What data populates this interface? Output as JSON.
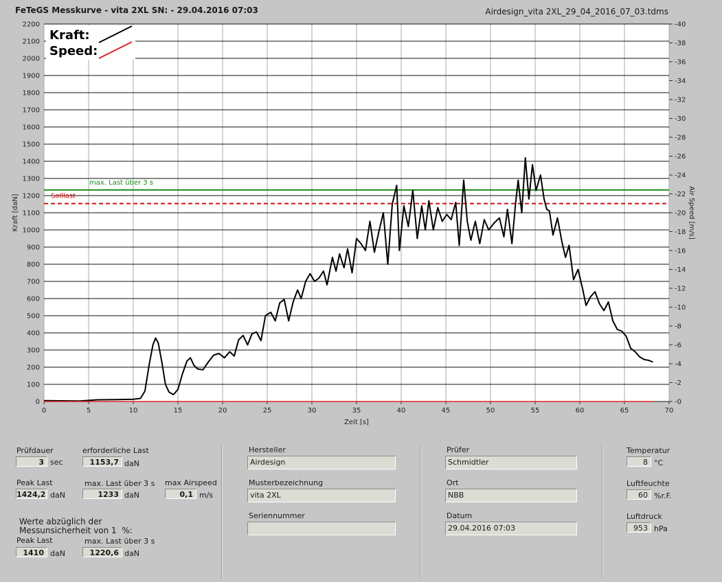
{
  "header": {
    "title": "FeTeGS Messkurve - vita 2XL  SN:  - 29.04.2016 07:03",
    "filename": "Airdesign_vita 2XL_29_04_2016_07_03.tdms"
  },
  "legend": {
    "kraft": "Kraft:",
    "speed": "Speed:"
  },
  "chart_data": {
    "type": "line",
    "xlabel": "Zeit [s]",
    "ylabel": "Kraft [daN]",
    "y2label": "Air Speed [m/s]",
    "xlim": [
      0,
      70
    ],
    "ylim": [
      0,
      2200
    ],
    "y2lim": [
      0,
      40
    ],
    "xticks": [
      0,
      5,
      10,
      15,
      20,
      25,
      30,
      35,
      40,
      45,
      50,
      55,
      60,
      65,
      70
    ],
    "yticks": [
      0,
      100,
      200,
      300,
      400,
      500,
      600,
      700,
      800,
      900,
      1000,
      1100,
      1200,
      1300,
      1400,
      1500,
      1600,
      1700,
      1800,
      1900,
      2000,
      2100,
      2200
    ],
    "y2ticks": [
      0,
      2,
      4,
      6,
      8,
      10,
      12,
      14,
      16,
      18,
      20,
      22,
      24,
      26,
      28,
      30,
      32,
      34,
      36,
      38,
      40
    ],
    "grid": true,
    "reference_lines": [
      {
        "label": "max. Last über  3 s",
        "value": 1233,
        "color": "#1a8a1a",
        "style": "solid"
      },
      {
        "label": "Solllast",
        "value": 1153.7,
        "color": "#cc1111",
        "style": "dashed"
      }
    ],
    "series": [
      {
        "name": "Kraft",
        "color": "#000000",
        "points": [
          [
            0,
            5
          ],
          [
            2,
            4
          ],
          [
            4,
            3
          ],
          [
            6,
            10
          ],
          [
            8,
            11
          ],
          [
            10,
            13
          ],
          [
            10.8,
            18
          ],
          [
            11.3,
            60
          ],
          [
            11.8,
            220
          ],
          [
            12.2,
            330
          ],
          [
            12.5,
            370
          ],
          [
            12.8,
            340
          ],
          [
            13.2,
            230
          ],
          [
            13.6,
            100
          ],
          [
            14,
            55
          ],
          [
            14.5,
            40
          ],
          [
            15,
            70
          ],
          [
            15.5,
            160
          ],
          [
            16,
            235
          ],
          [
            16.4,
            255
          ],
          [
            16.8,
            210
          ],
          [
            17.2,
            190
          ],
          [
            17.8,
            185
          ],
          [
            18.4,
            230
          ],
          [
            19,
            270
          ],
          [
            19.6,
            280
          ],
          [
            20.2,
            255
          ],
          [
            20.8,
            290
          ],
          [
            21.3,
            265
          ],
          [
            21.8,
            360
          ],
          [
            22.3,
            385
          ],
          [
            22.8,
            330
          ],
          [
            23.3,
            395
          ],
          [
            23.8,
            405
          ],
          [
            24.3,
            355
          ],
          [
            24.8,
            500
          ],
          [
            25.4,
            520
          ],
          [
            25.9,
            470
          ],
          [
            26.4,
            575
          ],
          [
            26.9,
            595
          ],
          [
            27.4,
            470
          ],
          [
            27.9,
            580
          ],
          [
            28.4,
            650
          ],
          [
            28.8,
            600
          ],
          [
            29.3,
            700
          ],
          [
            29.8,
            745
          ],
          [
            30.3,
            700
          ],
          [
            30.8,
            720
          ],
          [
            31.3,
            760
          ],
          [
            31.7,
            680
          ],
          [
            32.3,
            840
          ],
          [
            32.7,
            760
          ],
          [
            33.1,
            860
          ],
          [
            33.6,
            780
          ],
          [
            34,
            890
          ],
          [
            34.5,
            750
          ],
          [
            35,
            950
          ],
          [
            35.5,
            920
          ],
          [
            36,
            880
          ],
          [
            36.5,
            1050
          ],
          [
            37,
            870
          ],
          [
            37.5,
            990
          ],
          [
            38,
            1100
          ],
          [
            38.5,
            800
          ],
          [
            39,
            1150
          ],
          [
            39.5,
            1260
          ],
          [
            39.8,
            880
          ],
          [
            40.3,
            1140
          ],
          [
            40.8,
            1020
          ],
          [
            41.3,
            1230
          ],
          [
            41.8,
            950
          ],
          [
            42.3,
            1140
          ],
          [
            42.7,
            1000
          ],
          [
            43.1,
            1170
          ],
          [
            43.6,
            1000
          ],
          [
            44.1,
            1130
          ],
          [
            44.6,
            1050
          ],
          [
            45.1,
            1090
          ],
          [
            45.6,
            1060
          ],
          [
            46.1,
            1160
          ],
          [
            46.5,
            910
          ],
          [
            47,
            1290
          ],
          [
            47.4,
            1050
          ],
          [
            47.8,
            940
          ],
          [
            48.3,
            1050
          ],
          [
            48.8,
            920
          ],
          [
            49.3,
            1060
          ],
          [
            49.8,
            1000
          ],
          [
            50.4,
            1040
          ],
          [
            51,
            1070
          ],
          [
            51.5,
            960
          ],
          [
            51.9,
            1120
          ],
          [
            52.4,
            920
          ],
          [
            52.8,
            1150
          ],
          [
            53.1,
            1290
          ],
          [
            53.5,
            1100
          ],
          [
            53.9,
            1420
          ],
          [
            54.3,
            1180
          ],
          [
            54.7,
            1380
          ],
          [
            55.1,
            1230
          ],
          [
            55.6,
            1320
          ],
          [
            56,
            1180
          ],
          [
            56.3,
            1120
          ],
          [
            56.6,
            1110
          ],
          [
            57,
            970
          ],
          [
            57.5,
            1070
          ],
          [
            58,
            930
          ],
          [
            58.4,
            840
          ],
          [
            58.8,
            910
          ],
          [
            59.3,
            710
          ],
          [
            59.8,
            770
          ],
          [
            60.3,
            660
          ],
          [
            60.7,
            560
          ],
          [
            61.2,
            610
          ],
          [
            61.7,
            640
          ],
          [
            62.2,
            570
          ],
          [
            62.7,
            530
          ],
          [
            63.2,
            580
          ],
          [
            63.7,
            470
          ],
          [
            64.2,
            420
          ],
          [
            64.7,
            410
          ],
          [
            65.2,
            380
          ],
          [
            65.7,
            310
          ],
          [
            66.2,
            290
          ],
          [
            66.7,
            260
          ],
          [
            67.2,
            245
          ],
          [
            67.7,
            240
          ],
          [
            68.2,
            230
          ]
        ]
      },
      {
        "name": "Speed",
        "color": "#dd2222",
        "points": [
          [
            0,
            0
          ],
          [
            68.2,
            0
          ]
        ]
      }
    ]
  },
  "panel": {
    "pruefdauer": {
      "label": "Prüfdauer",
      "value": "3",
      "unit": "sec"
    },
    "erforderliche_last": {
      "label": "erforderliche Last",
      "value": "1153,7",
      "unit": "daN"
    },
    "peak_last": {
      "label": "Peak Last",
      "value": "1424,2",
      "unit": "daN"
    },
    "max_last": {
      "label": "max. Last über  3 s",
      "value": "1233",
      "unit": "daN"
    },
    "max_airspeed": {
      "label": "max Airspeed",
      "value": "0,1",
      "unit": "m/s"
    },
    "note": "Werte abzüglich der\nMessunsicherheit von 1  %:",
    "peak_last2": {
      "label": "Peak Last",
      "value": "1410",
      "unit": "daN"
    },
    "max_last2": {
      "label": "max. Last über  3 s",
      "value": "1220,6",
      "unit": "daN"
    },
    "hersteller": {
      "label": "Hersteller",
      "value": "Airdesign"
    },
    "musterbezeichnung": {
      "label": "Musterbezeichnung",
      "value": "vita 2XL"
    },
    "seriennummer": {
      "label": "Seriennummer",
      "value": ""
    },
    "pruefer": {
      "label": "Prüfer",
      "value": "Schmidtler"
    },
    "ort": {
      "label": "Ort",
      "value": "NBB"
    },
    "datum": {
      "label": "Datum",
      "value": "29.04.2016 07:03"
    },
    "temperatur": {
      "label": "Temperatur",
      "value": "8",
      "unit": "°C"
    },
    "luftfeuchte": {
      "label": "Luftfeuchte",
      "value": "60",
      "unit": "%r.F."
    },
    "luftdruck": {
      "label": "Luftdruck",
      "value": "953",
      "unit": "hPa"
    }
  }
}
